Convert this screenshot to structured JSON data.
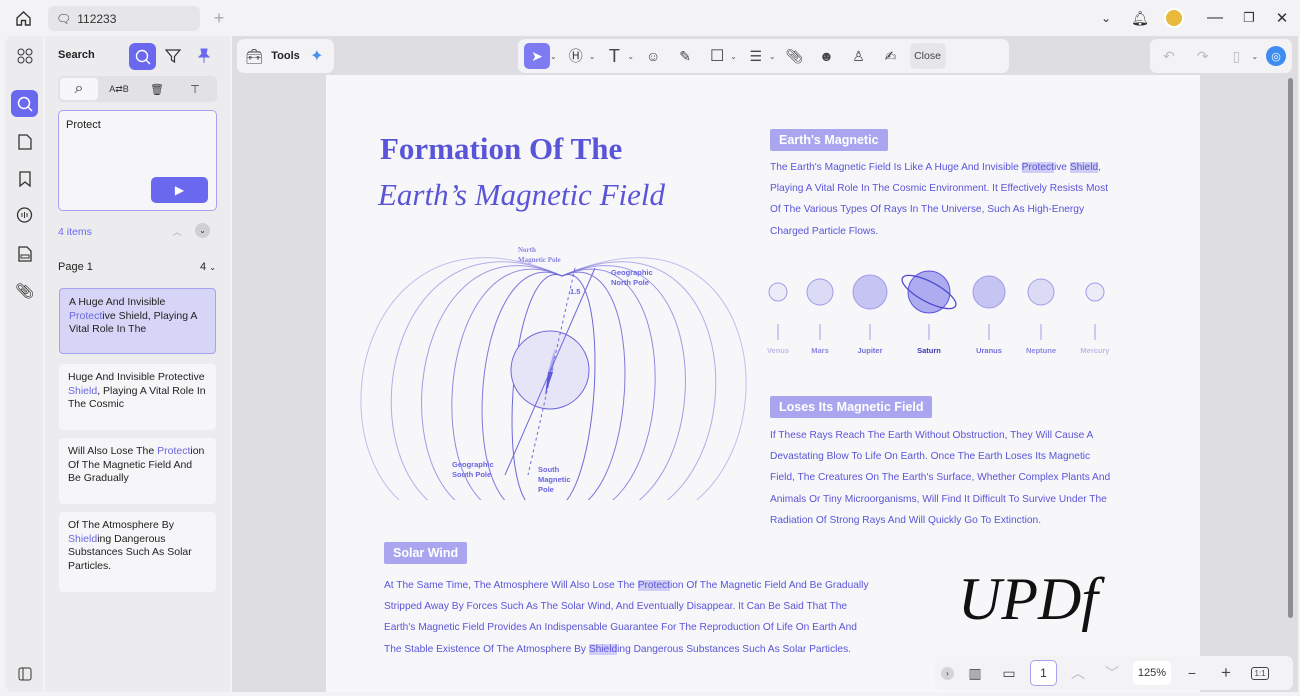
{
  "window": {
    "tab_title": "112233"
  },
  "panel": {
    "title": "Search",
    "query": "Protect",
    "count": "4 items",
    "page_label": "Page 1",
    "page_count": "4",
    "results": [
      [
        {
          "t": "A Huge And Invisible "
        },
        {
          "t": "Protect",
          "h": true
        },
        {
          "t": "ive Shield, Playing A Vital Role In The"
        }
      ],
      [
        {
          "t": "Huge And Invisible Protective "
        },
        {
          "t": "Shield",
          "h": true
        },
        {
          "t": ", Playing A Vital Role In The Cosmic"
        }
      ],
      [
        {
          "t": "Will Also Lose The "
        },
        {
          "t": "Protect",
          "h": true
        },
        {
          "t": "ion Of The Magnetic Field And Be Gradually"
        }
      ],
      [
        {
          "t": "Of The Atmosphere By "
        },
        {
          "t": "Shield",
          "h": true
        },
        {
          "t": "ing Dangerous Substances Such As Solar Particles."
        }
      ]
    ]
  },
  "toolbar": {
    "tools_label": "Tools",
    "close_label": "Close"
  },
  "doc": {
    "title1": "Formation Of The",
    "title2": "Earth’s Magnetic Field",
    "sec1_title": "Earth's Magnetic",
    "sec1": [
      [
        {
          "t": "The Earth's Magnetic Field Is Like A Huge And Invisible "
        },
        {
          "t": "Protect",
          "h": true
        },
        {
          "t": "ive "
        },
        {
          "t": "Shield",
          "h": true
        },
        {
          "t": ","
        }
      ],
      [
        {
          "t": "Playing A Vital Role In The Cosmic Environment. It Effectively Resists Most"
        }
      ],
      [
        {
          "t": "Of The Various Types Of Rays In The Universe, Such As High-Energy"
        }
      ],
      [
        {
          "t": "Charged Particle Flows."
        }
      ]
    ],
    "sec2_title": "Loses Its Magnetic Field",
    "sec2": [
      [
        {
          "t": "If These Rays Reach The Earth Without Obstruction, They Will Cause A"
        }
      ],
      [
        {
          "t": "Devastating Blow To Life On Earth. Once The Earth Loses Its Magnetic"
        }
      ],
      [
        {
          "t": "Field, The Creatures On The Earth's Surface, Whether Complex Plants And"
        }
      ],
      [
        {
          "t": "Animals Or Tiny Microorganisms, Will Find It Difficult To Survive Under The"
        }
      ],
      [
        {
          "t": "Radiation Of Strong Rays And Will Quickly Go To Extinction."
        }
      ]
    ],
    "sec3_title": "Solar Wind",
    "sec3": [
      [
        {
          "t": "At The Same Time, The Atmosphere Will Also Lose The "
        },
        {
          "t": "Protect",
          "h": true
        },
        {
          "t": "ion Of The Magnetic Field And Be Gradually"
        }
      ],
      [
        {
          "t": "Stripped Away By Forces Such As The Solar Wind, And Eventually Disappear. It Can Be Said That The"
        }
      ],
      [
        {
          "t": "Earth's Magnetic Field Provides An Indispensable Guarantee For The Reproduction Of Life On Earth And"
        }
      ],
      [
        {
          "t": "The Stable Existence Of The Atmosphere By "
        },
        {
          "t": "Shield",
          "h": true
        },
        {
          "t": "ing Dangerous Substances Such As Solar Particles."
        }
      ]
    ],
    "diagram": {
      "north_mag": "North",
      "north_mag2": "Magnetic Pole",
      "geo_north": "Geographic",
      "geo_north2": "North Pole",
      "angle": "1.5",
      "geo_south": "Geographic",
      "geo_south2": "South Pole",
      "south_mag": "South",
      "south_mag2": "Magnetic",
      "south_mag3": "Pole"
    },
    "planets": [
      "Venus",
      "Mars",
      "Jupiter",
      "Saturn",
      "Uranus",
      "Neptune",
      "Mercury"
    ],
    "logo": "UPDf"
  },
  "bottom": {
    "page": "1",
    "zoom": "125%"
  },
  "colors": {
    "accent": "#6b68f0",
    "doc_text": "#5a55d8"
  }
}
